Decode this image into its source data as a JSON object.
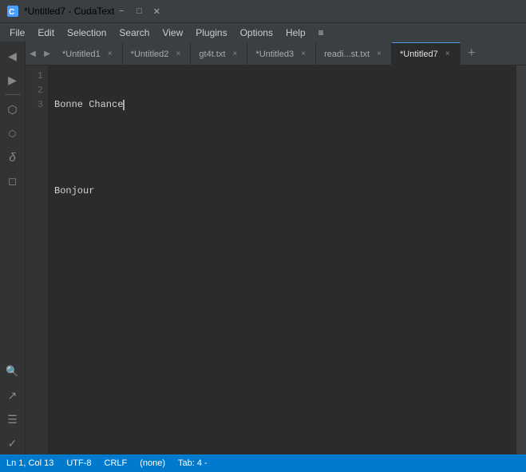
{
  "titleBar": {
    "title": "*Untitled7 - CudaText",
    "icon": "cudatext-icon",
    "minimizeLabel": "−",
    "maximizeLabel": "□",
    "closeLabel": "✕"
  },
  "menuBar": {
    "items": [
      "File",
      "Edit",
      "Selection",
      "Search",
      "View",
      "Plugins",
      "Options",
      "Help",
      "≡"
    ]
  },
  "sidebar": {
    "icons": [
      {
        "name": "sidebar-tree-icon",
        "glyph": "⬡",
        "active": false
      },
      {
        "name": "sidebar-code-icon",
        "glyph": "⬡",
        "active": false
      },
      {
        "name": "sidebar-variable-icon",
        "glyph": "δ",
        "active": false
      },
      {
        "name": "sidebar-folder-icon",
        "glyph": "🗁",
        "active": false
      }
    ]
  },
  "tabs": [
    {
      "label": "*Untitled1",
      "active": false,
      "closable": true
    },
    {
      "label": "*Untitled2",
      "active": false,
      "closable": true
    },
    {
      "label": "gt4t.txt",
      "active": false,
      "closable": true
    },
    {
      "label": "*Untitled3",
      "active": false,
      "closable": true
    },
    {
      "label": "readi...st.txt",
      "active": false,
      "closable": true
    },
    {
      "label": "*Untitled7",
      "active": true,
      "closable": true
    }
  ],
  "tabNavPrev": "◀",
  "tabNavNext": "▶",
  "tabAdd": "+",
  "editor": {
    "lines": [
      {
        "number": "1",
        "content": "Bonne Chance",
        "hasCursor": true
      },
      {
        "number": "2",
        "content": "",
        "hasCursor": false
      },
      {
        "number": "3",
        "content": "Bonjour",
        "hasCursor": false
      }
    ]
  },
  "statusBar": {
    "position": "Ln 1, Col 13",
    "encoding": "UTF-8",
    "lineEnding": "CRLF",
    "syntax": "(none)",
    "tabSize": "Tab: 4 -"
  }
}
